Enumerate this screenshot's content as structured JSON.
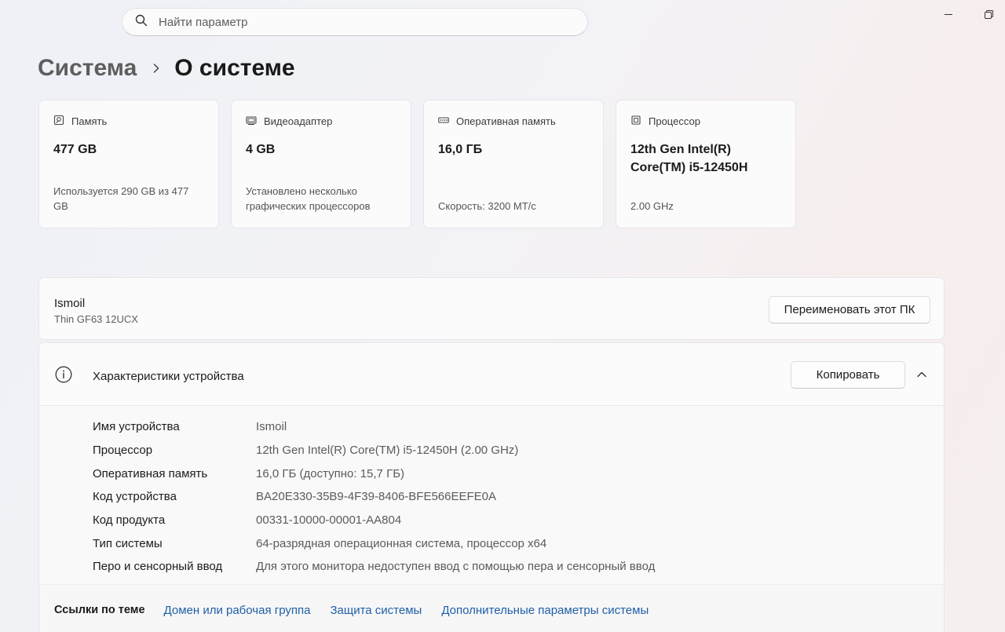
{
  "search": {
    "placeholder": "Найти параметр"
  },
  "breadcrumb": {
    "parent": "Система",
    "current": "О системе"
  },
  "cards": [
    {
      "icon": "storage-icon",
      "title": "Память",
      "value": "477 GB",
      "sub": "Используется 290 GB из 477 GB"
    },
    {
      "icon": "gpu-icon",
      "title": "Видеоадаптер",
      "value": "4 GB",
      "sub": "Установлено несколько графических процессоров"
    },
    {
      "icon": "ram-icon",
      "title": "Оперативная память",
      "value": "16,0 ГБ",
      "sub": "Скорость: 3200 MT/с"
    },
    {
      "icon": "cpu-icon",
      "title": "Процессор",
      "value": "12th Gen Intel(R) Core(TM) i5-12450H",
      "sub": "2.00 GHz"
    }
  ],
  "device": {
    "name": "Ismoil",
    "model": "Thin GF63 12UCX",
    "rename_label": "Переименовать этот ПК"
  },
  "specs": {
    "title": "Характеристики устройства",
    "copy_label": "Копировать",
    "rows": [
      {
        "label": "Имя устройства",
        "value": "Ismoil"
      },
      {
        "label": "Процессор",
        "value": "12th Gen Intel(R) Core(TM) i5-12450H (2.00 GHz)"
      },
      {
        "label": "Оперативная память",
        "value": "16,0 ГБ (доступно: 15,7 ГБ)"
      },
      {
        "label": "Код устройства",
        "value": "BA20E330-35B9-4F39-8406-BFE566EEFE0A"
      },
      {
        "label": "Код продукта",
        "value": "00331-10000-00001-AA804"
      },
      {
        "label": "Тип системы",
        "value": "64-разрядная операционная система, процессор x64"
      },
      {
        "label": "Перо и сенсорный ввод",
        "value": "Для этого монитора недоступен ввод с помощью пера и сенсорный ввод"
      }
    ]
  },
  "links": {
    "title": "Ссылки по теме",
    "items": [
      "Домен или рабочая группа",
      "Защита системы",
      "Дополнительные параметры системы"
    ]
  },
  "colors": {
    "link": "#1f5fa6",
    "accent": "#0067c0"
  }
}
